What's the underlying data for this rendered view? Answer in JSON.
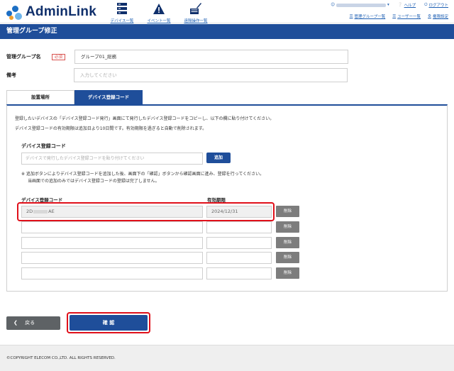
{
  "app": {
    "logo_text": "AdminLink"
  },
  "topnav": [
    {
      "label": "デバイス一覧",
      "icon": "server-icon"
    },
    {
      "label": "イベント一覧",
      "icon": "warning-triangle-icon"
    },
    {
      "label": "遠隔操作一覧",
      "icon": "remote-control-icon"
    }
  ],
  "user_menu": {
    "help": "ヘルプ",
    "logout": "ログアウト",
    "manage_groups": "管理グループ一覧",
    "users": "ユーザー一覧",
    "permissions": "権限設定"
  },
  "page": {
    "title": "管理グループ修正"
  },
  "form": {
    "group_name_label": "管理グループ名",
    "required_badge": "必須",
    "group_name_value": "グループ01_総務",
    "notes_label": "備考",
    "notes_placeholder": "入力してください"
  },
  "tabs": [
    {
      "label": "設置場所",
      "active": false
    },
    {
      "label": "デバイス登録コード",
      "active": true
    }
  ],
  "panel": {
    "desc_line1": "登録したいデバイスの「デバイス登録コード発行」画面にて発行したデバイス登録コードをコピーし、以下の欄に貼り付けてください。",
    "desc_line2": "デバイス登録コードの有効期限は追加日より10日間です。有効期限を過ぎると自動で削除されます。",
    "section_title": "デバイス登録コード",
    "code_placeholder": "デバイスで発行したデバイス登録コードを貼り付けてください",
    "add_button": "追加",
    "note_line1": "※ 追加ボタンによりデバイス登録コードを追加した後、画面下の「確認」ボタンから確認画面に進み、登録を行ってください。",
    "note_line2": "当画面での追加のみではデバイス登録コードの登録は完了しません。",
    "col_code": "デバイス登録コード",
    "col_expiry": "有効期限",
    "delete_label": "削除",
    "rows": [
      {
        "code_prefix": "2D",
        "code_suffix": "AE",
        "expiry": "2024/12/31"
      },
      {
        "code_prefix": "",
        "code_suffix": "",
        "expiry": ""
      },
      {
        "code_prefix": "",
        "code_suffix": "",
        "expiry": ""
      },
      {
        "code_prefix": "",
        "code_suffix": "",
        "expiry": ""
      },
      {
        "code_prefix": "",
        "code_suffix": "",
        "expiry": ""
      }
    ]
  },
  "actions": {
    "back": "戻る",
    "confirm": "確 認"
  },
  "footer": {
    "copyright": "©COPYRIGHT ELECOM CO.,LTD. ALL RIGHTS RESERVED."
  },
  "colors": {
    "primary": "#1f4e9a",
    "highlight": "#e0101a",
    "required": "#d9534f",
    "delete_button": "#7d7d7d"
  }
}
